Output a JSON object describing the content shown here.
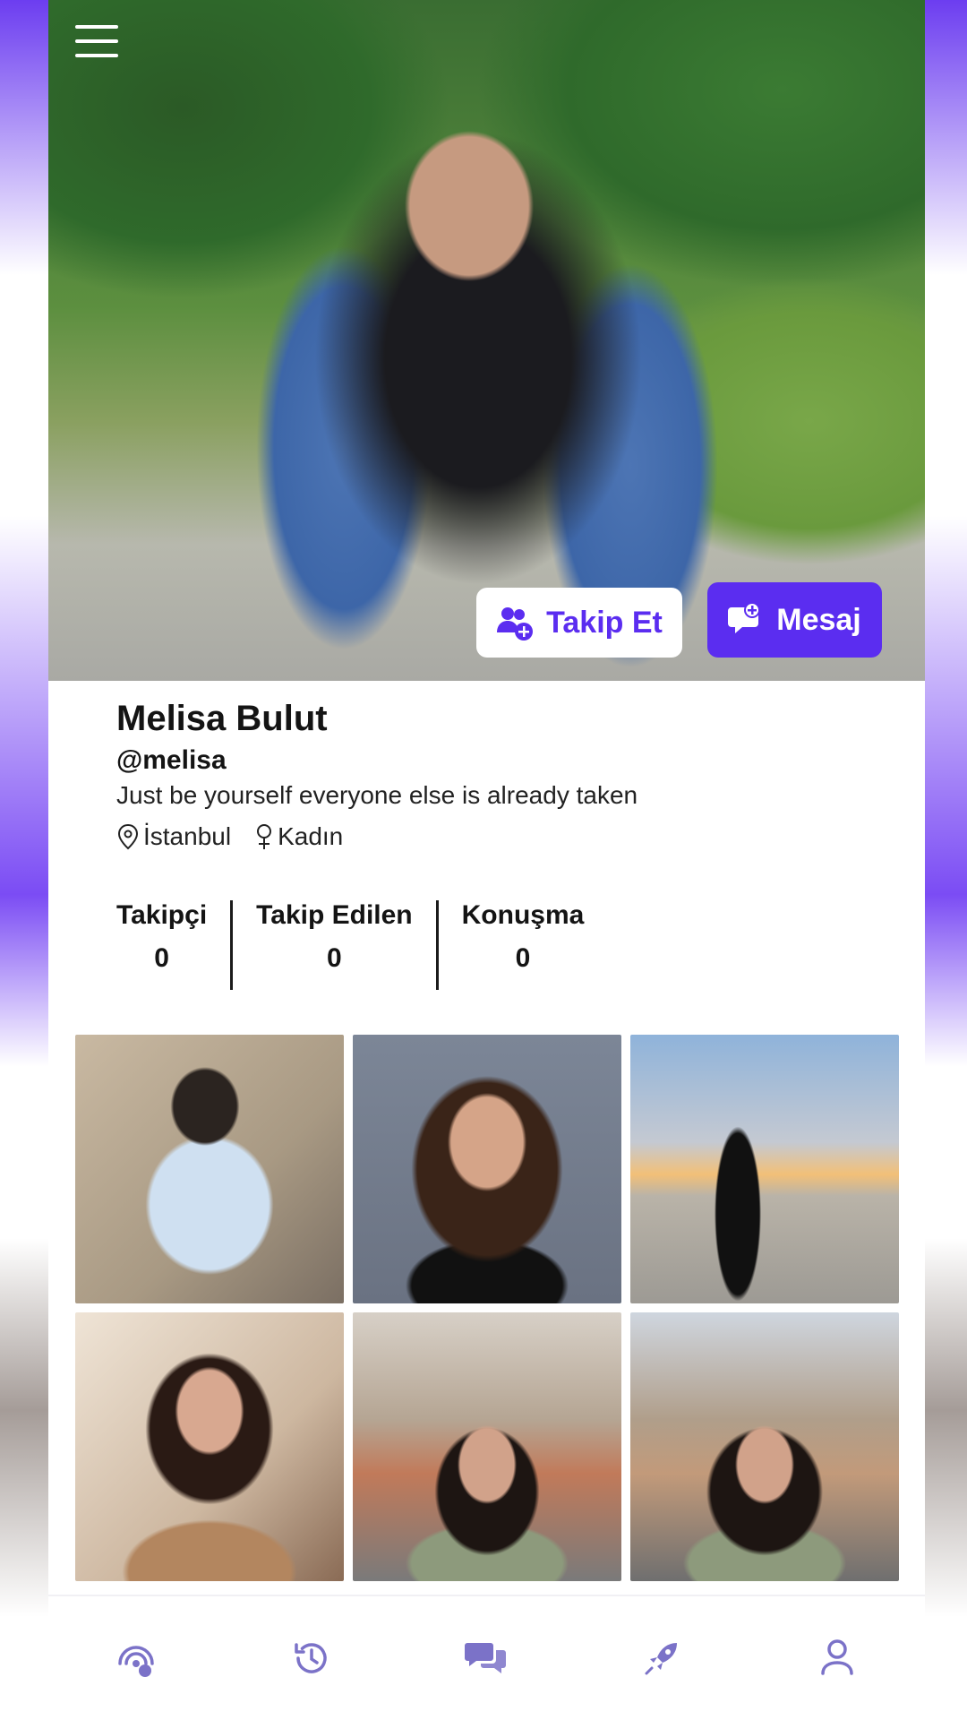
{
  "profile": {
    "name": "Melisa Bulut",
    "handle": "@melisa",
    "bio": "Just be yourself everyone else is already taken",
    "location": "İstanbul",
    "gender": "Kadın"
  },
  "actions": {
    "follow_label": "Takip Et",
    "message_label": "Mesaj"
  },
  "stats": [
    {
      "label": "Takipçi",
      "value": "0"
    },
    {
      "label": "Takip Edilen",
      "value": "0"
    },
    {
      "label": "Konuşma",
      "value": "0"
    }
  ],
  "gallery": [
    {
      "icon": "photo-1"
    },
    {
      "icon": "photo-2"
    },
    {
      "icon": "photo-3"
    },
    {
      "icon": "photo-4"
    },
    {
      "icon": "photo-5"
    },
    {
      "icon": "photo-6"
    }
  ],
  "nav": [
    {
      "icon": "discover-icon"
    },
    {
      "icon": "history-icon"
    },
    {
      "icon": "chat-icon"
    },
    {
      "icon": "boost-icon"
    },
    {
      "icon": "profile-icon"
    }
  ],
  "colors": {
    "accent": "#5b2df0",
    "nav_icon": "#7b72c8",
    "text": "#141414"
  }
}
